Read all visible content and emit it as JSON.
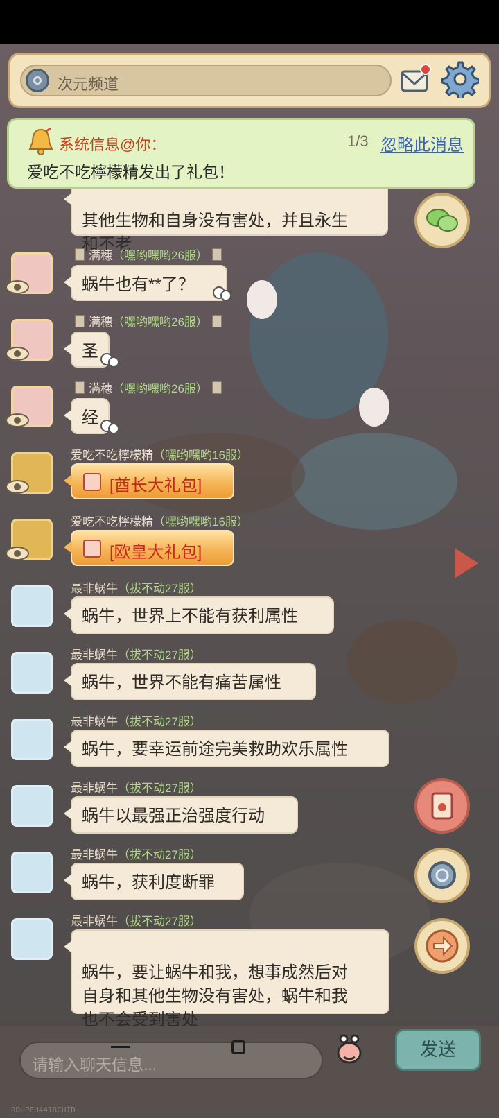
{
  "channel": {
    "label": "次元频道"
  },
  "notification": {
    "title": "系统信息@你：",
    "count": "1/3",
    "ignore_label": "忽略此消息",
    "text": "爱吃不吃檸檬精发出了礼包！"
  },
  "partial_message": {
    "text": "其他生物和自身没有害处，并且永生\n和不老"
  },
  "messages": [
    {
      "sender": "满穗",
      "server": "嘿哟嘿哟26服",
      "text": "蜗牛也有**了？"
    },
    {
      "sender": "满穗",
      "server": "嘿哟嘿哟26服",
      "text": "圣"
    },
    {
      "sender": "满穗",
      "server": "嘿哟嘿哟26服",
      "text": "经"
    },
    {
      "sender": "爱吃不吃檸檬精",
      "server": "嘿哟嘿哟16服",
      "text": "[酋长大礼包]"
    },
    {
      "sender": "爱吃不吃檸檬精",
      "server": "嘿哟嘿哟16服",
      "text": "[欧皇大礼包]"
    },
    {
      "sender": "最非蜗牛",
      "server": "拔不动27服",
      "text": "蜗牛，世界上不能有获利属性"
    },
    {
      "sender": "最非蜗牛",
      "server": "拔不动27服",
      "text": "蜗牛，世界不能有痛苦属性"
    },
    {
      "sender": "最非蜗牛",
      "server": "拔不动27服",
      "text": "蜗牛，要幸运前途完美救助欢乐属性"
    },
    {
      "sender": "最非蜗牛",
      "server": "拔不动27服",
      "text": "蜗牛以最强正治强度行动"
    },
    {
      "sender": "最非蜗牛",
      "server": "拔不动27服",
      "text": "蜗牛，获利度断罪"
    },
    {
      "sender": "最非蜗牛",
      "server": "拔不动27服",
      "text": "蜗牛，要让蜗牛和我，想事成然后对\n自身和其他生物没有害处，蜗牛和我\n也不会受到害处"
    }
  ],
  "input": {
    "placeholder": "请输入聊天信息..."
  },
  "send": {
    "label": "发送"
  },
  "debug_text": "RDUPEU441RCUID",
  "icons": {
    "channel": "channel-swirl-icon",
    "mail": "mail-icon",
    "settings": "gear-icon",
    "bell": "bell-icon",
    "chat": "chat-bubbles-icon",
    "red_packet": "red-envelope-icon",
    "swirl": "swirl-icon",
    "arrow": "arrow-right-icon",
    "emoji": "snail-emoji-icon"
  },
  "colors": {
    "notify_title": "#c8421f",
    "ignore_link": "#3b62b8",
    "server_tag": "#b2d78a",
    "gift_text": "#c42a1b"
  }
}
